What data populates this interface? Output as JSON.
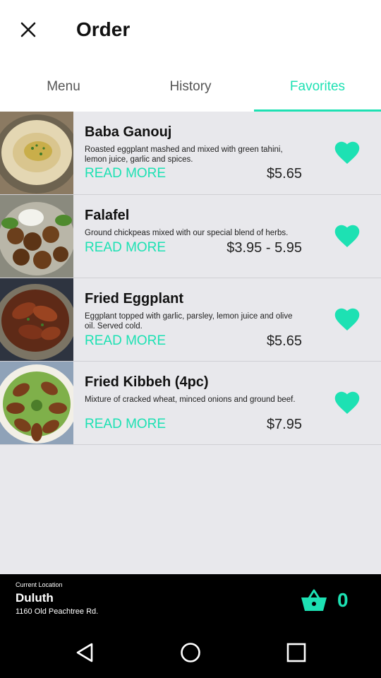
{
  "header": {
    "title": "Order"
  },
  "tabs": [
    {
      "label": "Menu"
    },
    {
      "label": "History"
    },
    {
      "label": "Favorites"
    }
  ],
  "items": [
    {
      "name": "Baba Ganouj",
      "description": "Roasted eggplant mashed and mixed with green tahini, lemon juice, garlic and spices.",
      "read_more": "READ MORE",
      "price": "$5.65",
      "favorited": true
    },
    {
      "name": "Falafel",
      "description": "Ground chickpeas mixed with our special blend of herbs.",
      "read_more": "READ MORE",
      "price": "$3.95 - 5.95",
      "favorited": true
    },
    {
      "name": "Fried Eggplant",
      "description": "Eggplant topped with garlic, parsley, lemon juice and olive oil. Served cold.",
      "read_more": "READ MORE",
      "price": "$5.65",
      "favorited": true
    },
    {
      "name": "Fried Kibbeh (4pc)",
      "description": "Mixture of cracked wheat, minced onions and ground beef.",
      "read_more": "READ MORE",
      "price": "$7.95",
      "favorited": true
    }
  ],
  "location": {
    "label": "Current Location",
    "city": "Duluth",
    "address": "1160 Old Peachtree Rd."
  },
  "cart": {
    "count": "0"
  },
  "colors": {
    "accent": "#1de1b3",
    "background": "#e8e8ec",
    "bar": "#000000"
  },
  "icons": [
    "close-icon",
    "heart-icon",
    "basket-icon",
    "back-icon",
    "home-icon",
    "recents-icon"
  ]
}
